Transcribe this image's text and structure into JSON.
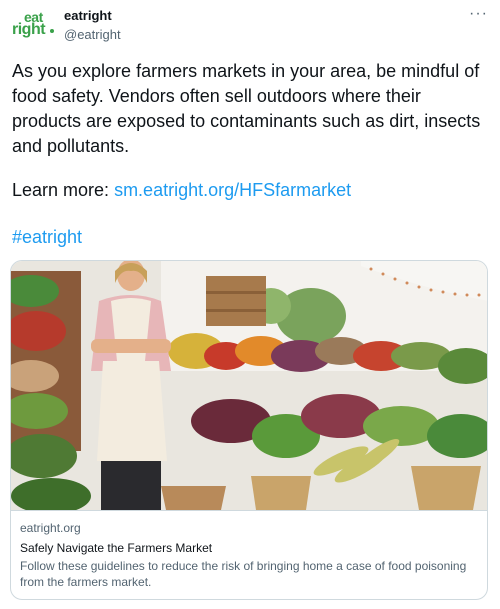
{
  "author": {
    "display_name": "eatright",
    "handle": "@eatright",
    "avatar_line1": "eat",
    "avatar_line2": "right",
    "avatar_color": "#3aa14a"
  },
  "tweet": {
    "text": "As you explore farmers markets in your area, be mindful of food safety. Vendors often sell outdoors where their products are exposed to contaminants such as dirt, insects and pollutants.",
    "learn_more_label": "Learn more: ",
    "link_text": "sm.eatright.org/HFSfarmarket",
    "hashtag": "#eatright",
    "more_menu": "···"
  },
  "card": {
    "domain": "eatright.org",
    "title": "Safely Navigate the Farmers Market",
    "description": "Follow these guidelines to reduce the risk of bringing home a case of food poisoning from the farmers market."
  },
  "colors": {
    "link": "#1d9bf0",
    "text": "#0f1419",
    "secondary": "#536471",
    "border": "#cfd9de"
  }
}
